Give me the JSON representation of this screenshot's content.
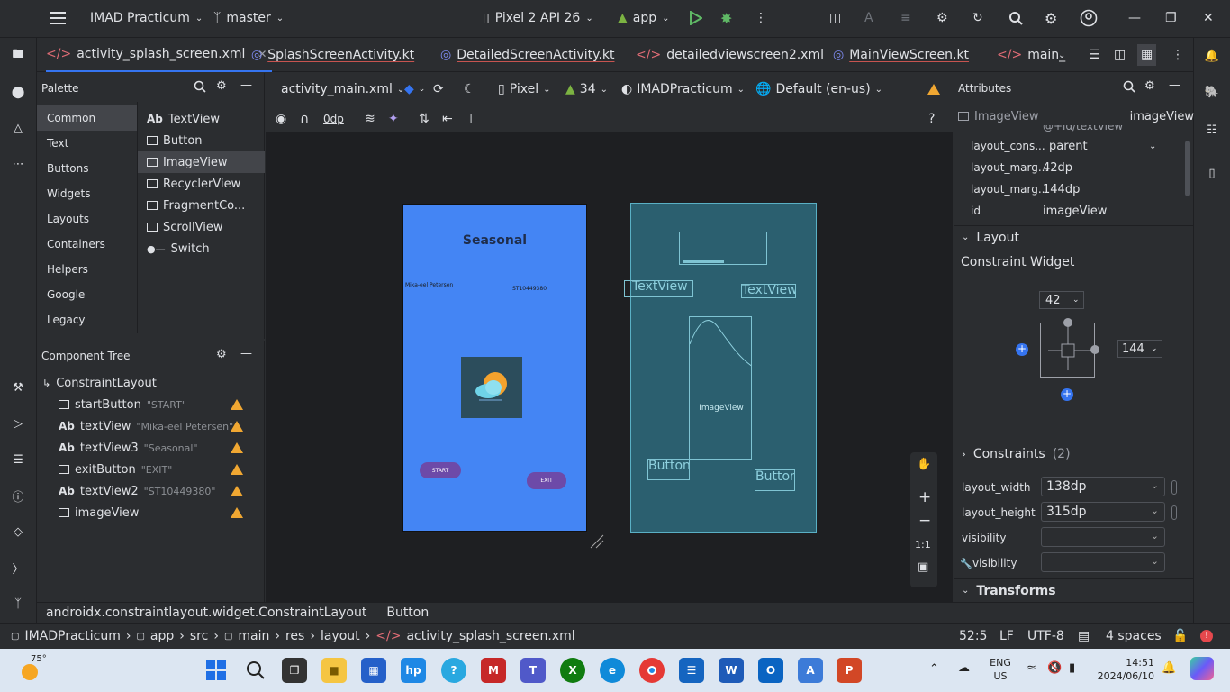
{
  "titlebar": {
    "project": "IMAD Practicum",
    "branch": "master",
    "device": "Pixel 2 API 26",
    "run_config": "app"
  },
  "tabs": [
    {
      "label": "activity_splash_screen.xml",
      "active": true
    },
    {
      "label": "SplashScreenActivity.kt"
    },
    {
      "label": "DetailedScreenActivity.kt"
    },
    {
      "label": "detailedviewscreen2.xml"
    },
    {
      "label": "MainViewScreen.kt"
    },
    {
      "label": "main_"
    }
  ],
  "palette": {
    "title": "Palette",
    "categories": [
      "Common",
      "Text",
      "Buttons",
      "Widgets",
      "Layouts",
      "Containers",
      "Helpers",
      "Google",
      "Legacy"
    ],
    "items": [
      {
        "prefix": "Ab",
        "label": "TextView"
      },
      {
        "prefix": "",
        "label": "Button"
      },
      {
        "prefix": "",
        "label": "ImageView"
      },
      {
        "prefix": "",
        "label": "RecyclerView"
      },
      {
        "prefix": "",
        "label": "FragmentCo..."
      },
      {
        "prefix": "",
        "label": "ScrollView"
      },
      {
        "prefix": "",
        "label": "Switch"
      }
    ]
  },
  "tree": {
    "title": "Component Tree",
    "root": "ConstraintLayout",
    "rows": [
      {
        "name": "startButton",
        "sub": "\"START\"",
        "prefix": ""
      },
      {
        "name": "textView",
        "sub": "\"Mika-eel Petersen\"",
        "prefix": "Ab"
      },
      {
        "name": "textView3",
        "sub": "\"Seasonal\"",
        "prefix": "Ab"
      },
      {
        "name": "exitButton",
        "sub": "\"EXIT\"",
        "prefix": ""
      },
      {
        "name": "textView2",
        "sub": "\"ST10449380\"",
        "prefix": "Ab"
      },
      {
        "name": "imageView",
        "sub": "",
        "prefix": ""
      }
    ]
  },
  "editor": {
    "file": "activity_main.xml",
    "device": "Pixel",
    "api": "34",
    "theme": "IMADPracticum",
    "locale": "Default (en-us)",
    "margin": "0dp"
  },
  "design": {
    "title": "Seasonal",
    "name": "Mika-eel Petersen",
    "student_no": "ST10449380",
    "start": "START",
    "exit": "EXIT"
  },
  "blueprint": {
    "tv1": "TextView",
    "tv2": "TextView",
    "image": "ImageView",
    "btn1": "Button",
    "btn2": "Button"
  },
  "zoom": {
    "ratio": "1:1"
  },
  "attributes": {
    "title": "Attributes",
    "widget": "ImageView",
    "id_header": "imageView",
    "rows": [
      {
        "k": "layout_cons...",
        "v": "parent"
      },
      {
        "k": "layout_marg...",
        "v": "42dp"
      },
      {
        "k": "layout_marg...",
        "v": "144dp"
      },
      {
        "k": "id",
        "v": "imageView"
      }
    ],
    "partial_row": "@+id/textView",
    "layout_section": "Layout",
    "constraint_widget": "Constraint Widget",
    "margin_top": "42",
    "margin_end": "144",
    "constraints": "Constraints",
    "constraints_count": "(2)",
    "layout_width_label": "layout_width",
    "layout_width": "138dp",
    "layout_height_label": "layout_height",
    "layout_height": "315dp",
    "visibility_label": "visibility",
    "tools_visibility_label": "visibility",
    "transforms": "Transforms"
  },
  "breadcrumb": [
    "androidx.constraintlayout.widget.ConstraintLayout",
    "Button"
  ],
  "status": {
    "path": [
      "IMADPracticum",
      "app",
      "src",
      "main",
      "res",
      "layout",
      "activity_splash_screen.xml"
    ],
    "position": "52:5",
    "line_sep": "LF",
    "encoding": "UTF-8",
    "indent": "4 spaces"
  },
  "taskbar": {
    "weather": "75°",
    "lang1": "ENG",
    "lang2": "US",
    "time": "14:51",
    "date": "2024/06/10"
  },
  "colors": {
    "accent": "#3574f0",
    "warning": "#f0a732",
    "design_bg": "#4485f4",
    "blueprint_bg": "#2b5f6f"
  }
}
